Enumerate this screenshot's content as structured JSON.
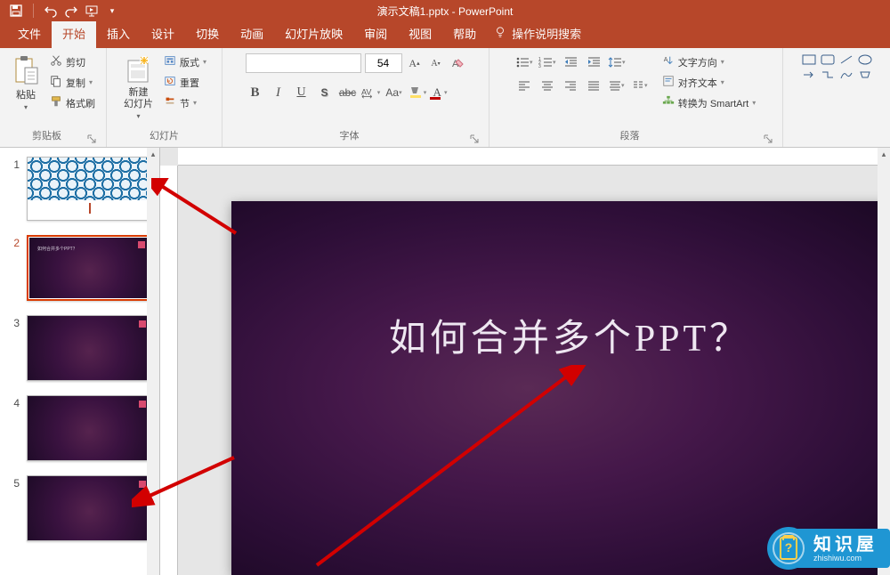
{
  "title": "演示文稿1.pptx - PowerPoint",
  "tabs": [
    "文件",
    "开始",
    "插入",
    "设计",
    "切换",
    "动画",
    "幻灯片放映",
    "审阅",
    "视图",
    "帮助"
  ],
  "tellme": "操作说明搜索",
  "clipboard": {
    "paste": "粘贴",
    "cut": "剪切",
    "copy": "复制",
    "fmt": "格式刷",
    "label": "剪贴板"
  },
  "slides": {
    "new": "新建\n幻灯片",
    "layout": "版式",
    "reset": "重置",
    "section": "节",
    "label": "幻灯片"
  },
  "font": {
    "name": "",
    "size": "54",
    "label": "字体"
  },
  "para": {
    "dir": "文字方向",
    "align": "对齐文本",
    "smart": "转换为 SmartArt",
    "label": "段落"
  },
  "slide_title": "如何合并多个PPT？",
  "thumbs": {
    "t2_text": "如何合并多个PPT？"
  },
  "wm": {
    "brand": "知识屋",
    "url": "zhishiwu.com",
    "q": "?"
  }
}
